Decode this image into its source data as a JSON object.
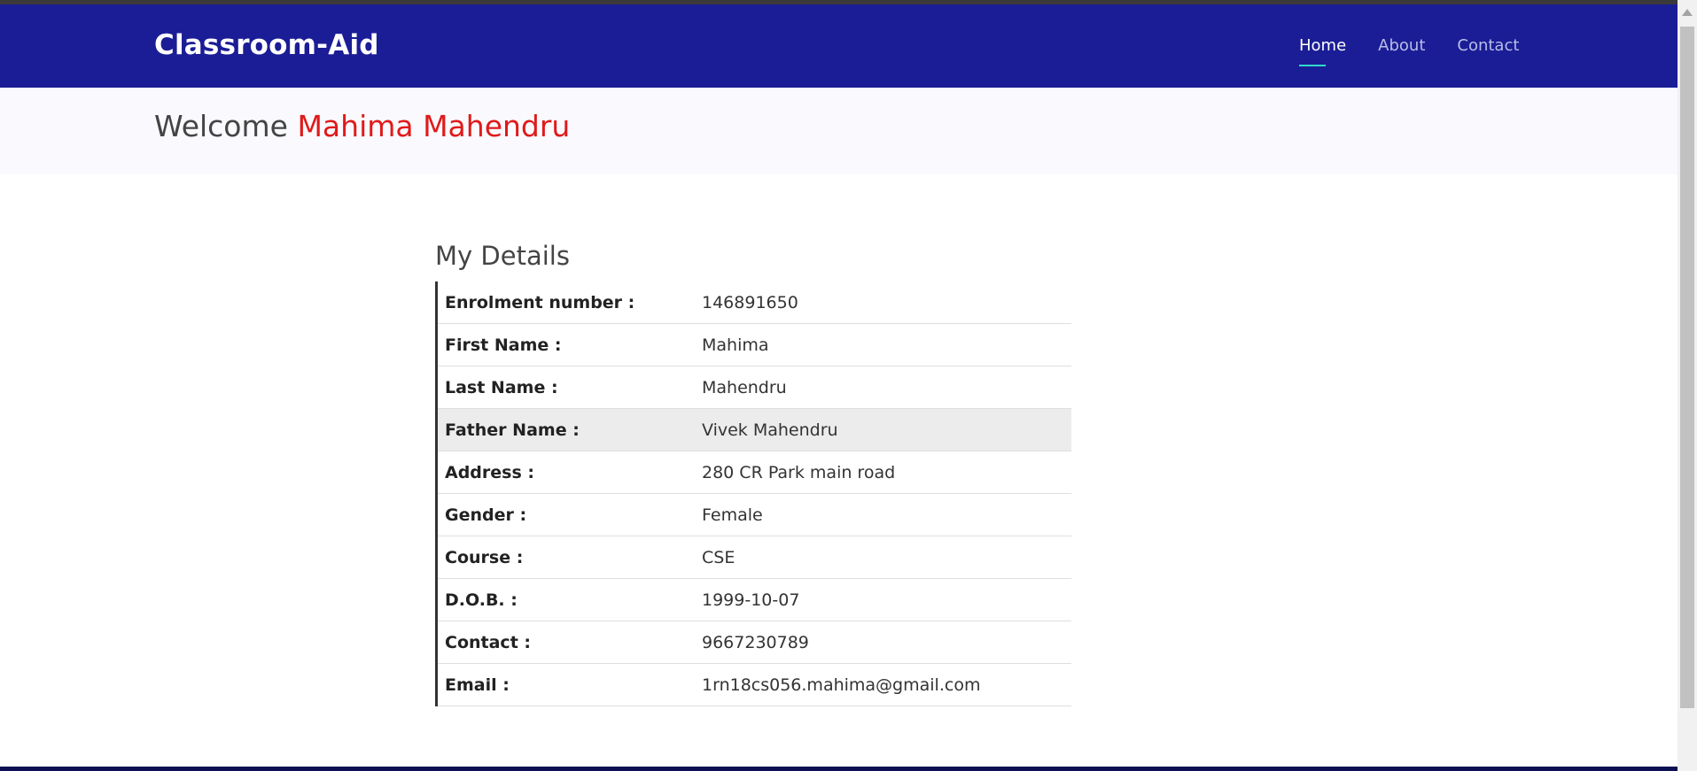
{
  "navbar": {
    "brand": "Classroom-Aid",
    "links": [
      {
        "label": "Home",
        "active": true
      },
      {
        "label": "About",
        "active": false
      },
      {
        "label": "Contact",
        "active": false
      }
    ]
  },
  "welcome": {
    "prefix": "Welcome",
    "name": "Mahima Mahendru"
  },
  "details": {
    "title": "My Details",
    "rows": [
      {
        "label": "Enrolment number :",
        "value": "146891650"
      },
      {
        "label": "First Name :",
        "value": "Mahima"
      },
      {
        "label": "Last Name :",
        "value": "Mahendru"
      },
      {
        "label": "Father Name :",
        "value": "Vivek Mahendru"
      },
      {
        "label": "Address :",
        "value": "280 CR Park main road"
      },
      {
        "label": "Gender :",
        "value": "Female"
      },
      {
        "label": "Course :",
        "value": "CSE"
      },
      {
        "label": "D.O.B. :",
        "value": "1999-10-07"
      },
      {
        "label": "Contact :",
        "value": "9667230789"
      },
      {
        "label": "Email :",
        "value": "1rn18cs056.mahima@gmail.com"
      }
    ]
  },
  "colors": {
    "navbar_bg": "#1b1d96",
    "welcome_name": "#e01a1a",
    "nav_active_underline": "#2fd9c9"
  }
}
